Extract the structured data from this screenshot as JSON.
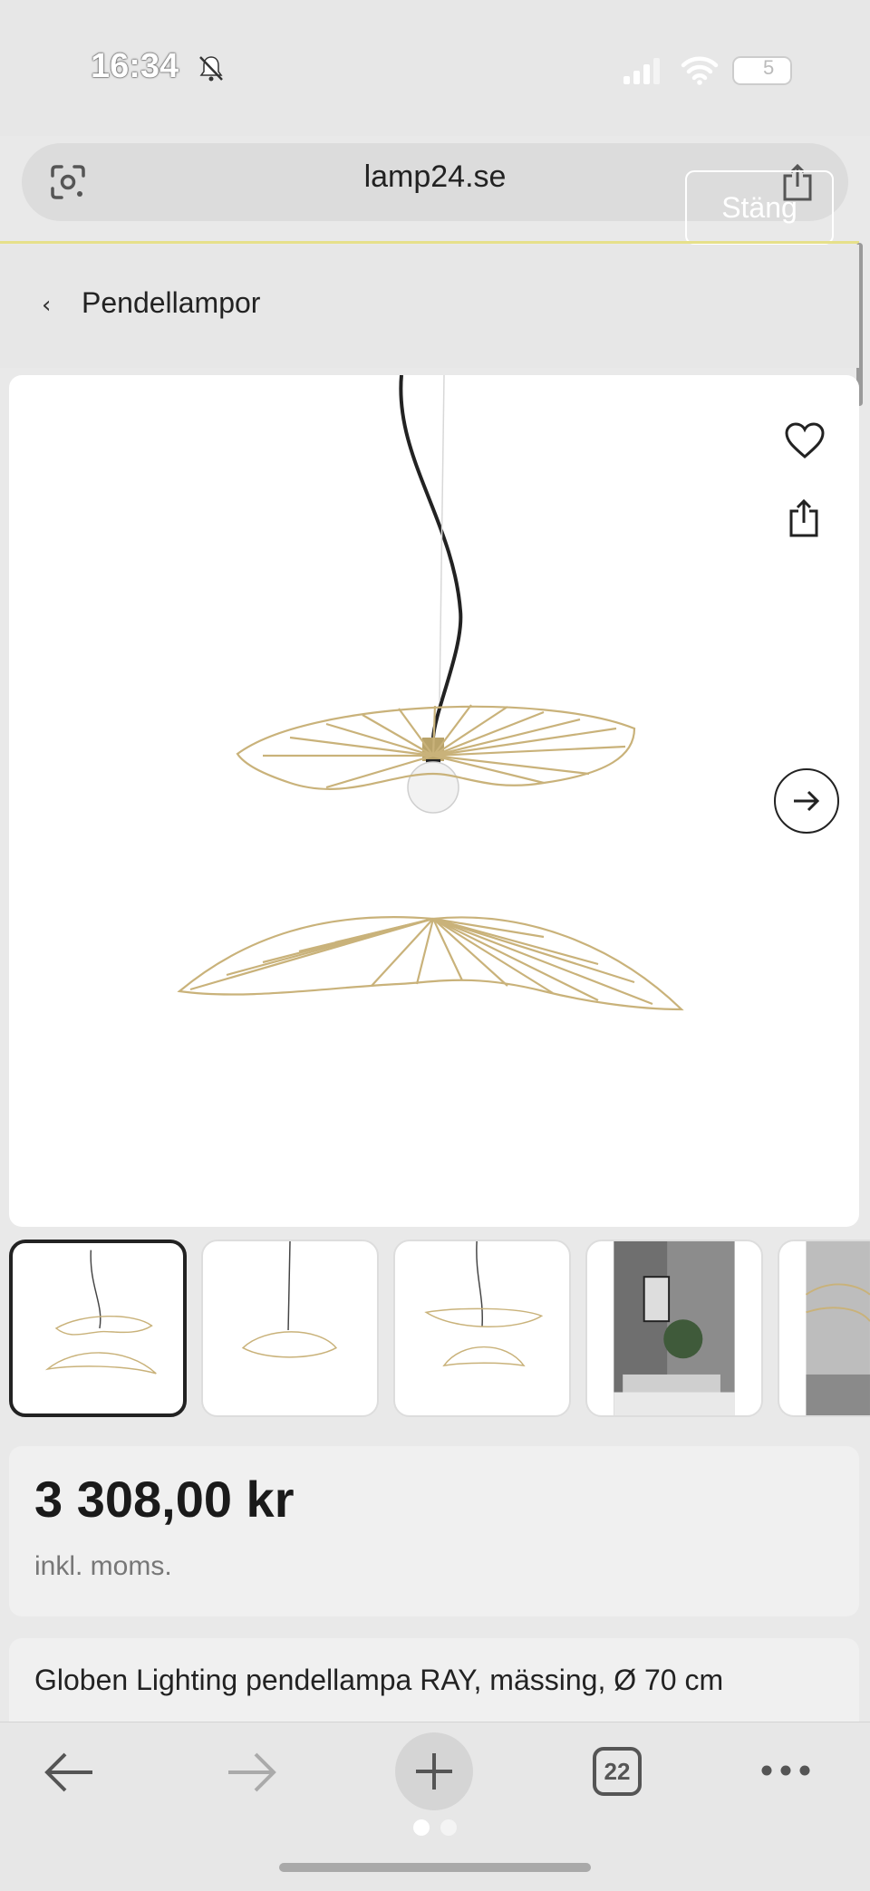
{
  "status_bar": {
    "time": "16:34",
    "battery_level": "5",
    "icons": [
      "bell-slash-icon",
      "cellular-signal-icon",
      "wifi-icon",
      "battery-icon"
    ]
  },
  "address_bar": {
    "url": "lamp24.se",
    "close_label": "Stäng",
    "icons": [
      "google-lens-icon",
      "share-icon"
    ]
  },
  "breadcrumb": {
    "label": "Pendellampor"
  },
  "product": {
    "price": "3 308,00 kr",
    "vat_note": "inkl. moms.",
    "title": "Globen Lighting pendellampa RAY, mässing, Ø 70 cm",
    "thumbnail_count": 5,
    "active_thumbnail": 0
  },
  "toolbar": {
    "tab_count": "22",
    "icons": [
      "back-arrow-icon",
      "forward-arrow-icon",
      "plus-icon",
      "tabs-icon",
      "more-icon"
    ]
  },
  "page_indicator": {
    "pages": 2,
    "active": 0
  },
  "colors": {
    "brass": "#c9b27a",
    "accent_line": "#e6e08a"
  }
}
